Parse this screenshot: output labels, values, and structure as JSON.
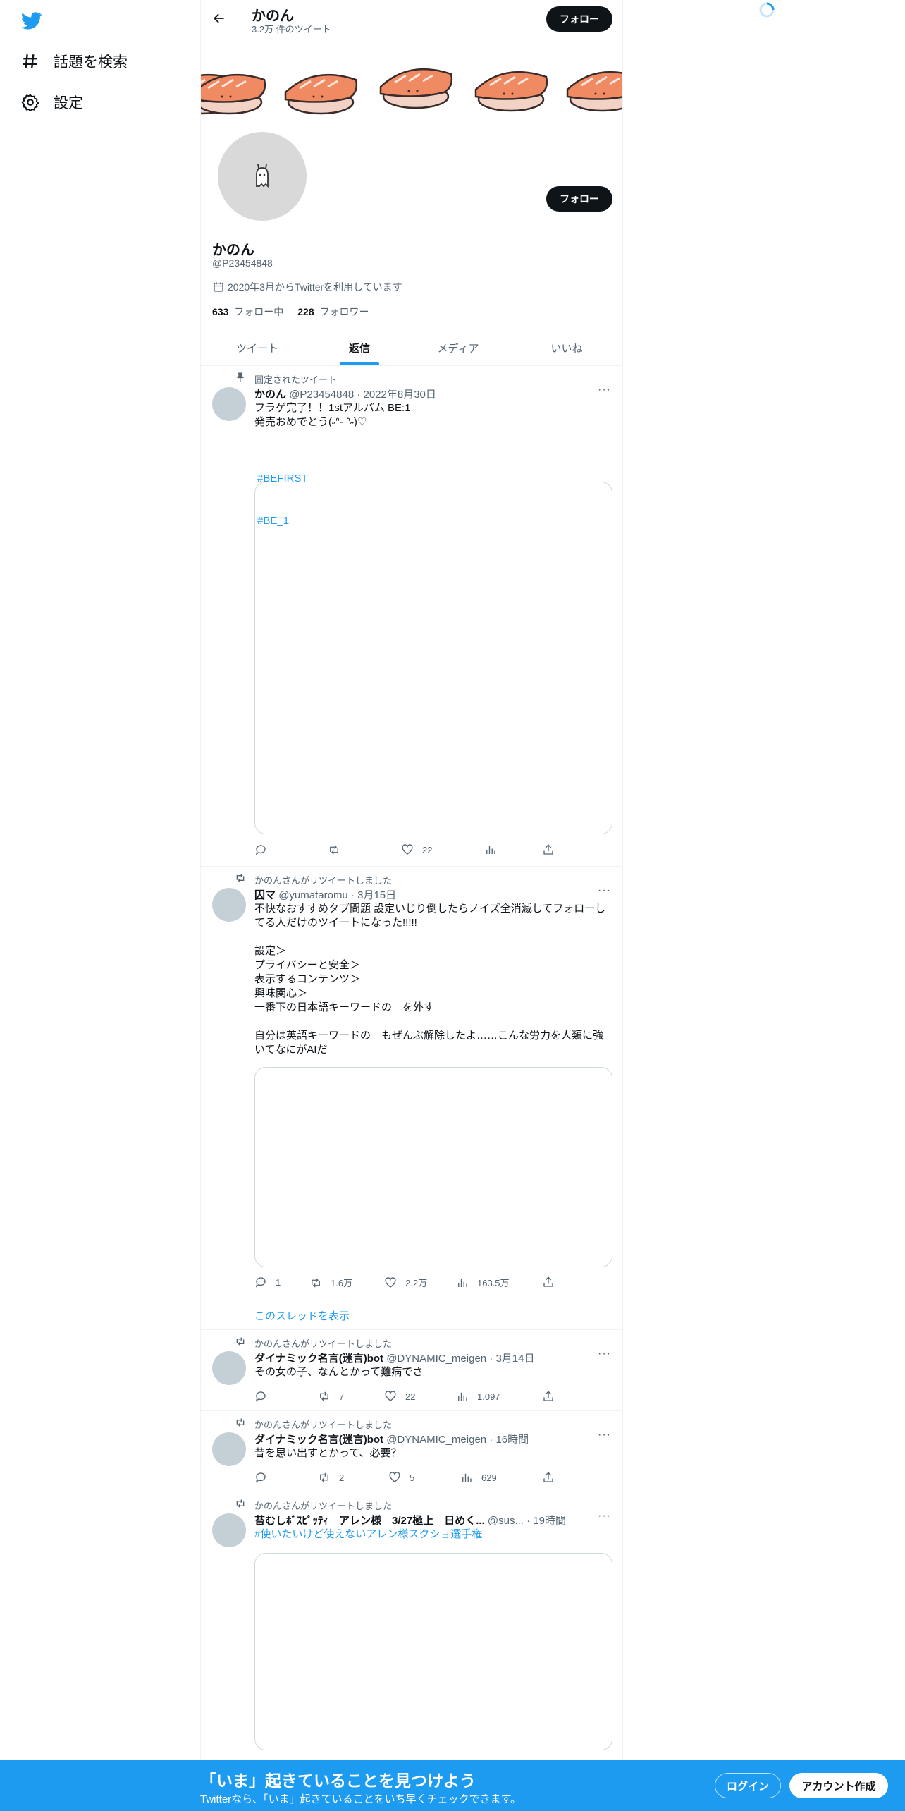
{
  "nav": {
    "explore_label": "話題を検索",
    "settings_label": "設定"
  },
  "header": {
    "title": "かのん",
    "tweet_count": "3.2万 件のツイート",
    "follow_label": "フォロー"
  },
  "profile": {
    "name": "かのん",
    "handle": "@P23454848",
    "joined": "2020年3月からTwitterを利用しています",
    "following_count": "633",
    "following_label": "フォロー中",
    "followers_count": "228",
    "followers_label": "フォロワー",
    "follow_label": "フォロー"
  },
  "tabs": [
    {
      "label": "ツイート",
      "active": false
    },
    {
      "label": "返信",
      "active": true
    },
    {
      "label": "メディア",
      "active": false
    },
    {
      "label": "いいね",
      "active": false
    }
  ],
  "tweets": [
    {
      "context": "固定されたツイート",
      "name": "かのん",
      "meta": "@P23454848 · 2022年8月30日",
      "text": "フラゲ完了！！1stアルバム BE:1\n発売おめでとう(˶ᐢ- ᐢ˶)♡",
      "hashtags": [
        "#BEFIRST",
        "#BE_1"
      ],
      "reply": "",
      "retweet": "",
      "like": "22",
      "views": ""
    },
    {
      "context": "かのんさんがリツイートしました",
      "name": "囚マ",
      "meta": "@yumataromu · 3月15日",
      "text": "不快なおすすめタブ問題 設定いじり倒したらノイズ全消滅してフォローしてる人だけのツイートになった!!!!!\n\n設定＞\nプライバシーと安全＞\n表示するコンテンツ＞\n興味関心＞\n一番下の日本語キーワードの　を外す\n\n自分は英語キーワードの　もぜんぶ解除したよ……こんな労力を人類に強いてなにがAIだ",
      "reply": "1",
      "retweet": "1.6万",
      "like": "2.2万",
      "views": "163.5万",
      "thread_link": "このスレッドを表示"
    },
    {
      "context": "かのんさんがリツイートしました",
      "name": "ダイナミック名言(迷言)bot",
      "meta": "@DYNAMIC_meigen · 3月14日",
      "text": "その女の子、なんとかって難病でさ",
      "reply": "",
      "retweet": "7",
      "like": "22",
      "views": "1,097"
    },
    {
      "context": "かのんさんがリツイートしました",
      "name": "ダイナミック名言(迷言)bot",
      "meta": "@DYNAMIC_meigen · 16時間",
      "text": "昔を思い出すとかって、必要？",
      "reply": "",
      "retweet": "2",
      "like": "5",
      "views": "629"
    },
    {
      "context": "かのんさんがリツイートしました",
      "name": "苔むしﾎﾞｽﾋﾟｯﾃｨ　アレン様　3/27極上　日めく...",
      "meta": "@sus... · 19時間",
      "hashtag_line": "#使いたいけど使えないアレン様スクショ選手権"
    }
  ],
  "bottom_bar": {
    "headline": "「いま」起きていることを見つけよう",
    "subtext": "Twitterなら、「いま」起きていることをいち早くチェックできます。",
    "login_label": "ログイン",
    "signup_label": "アカウント作成"
  },
  "colors": {
    "accent": "#1d9bf0",
    "banner_bg": "#ffffff",
    "salmon": "#f08a62"
  }
}
